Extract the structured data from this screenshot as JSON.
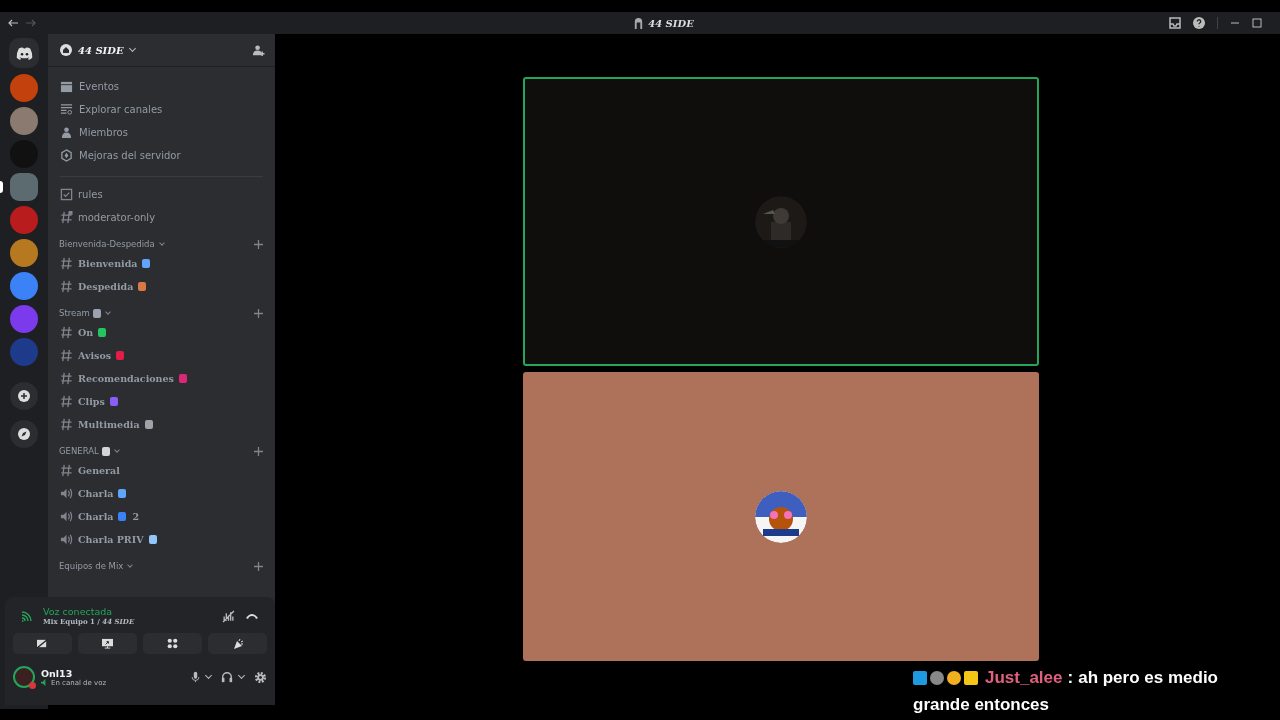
{
  "window": {
    "title": "44 SIDE"
  },
  "servers": [
    {
      "color": "#c2410c",
      "selected": false
    },
    {
      "color": "#8a7a70",
      "selected": false
    },
    {
      "color": "#111111",
      "selected": false
    },
    {
      "color": "#5b6b70",
      "selected": true
    },
    {
      "color": "#b91c1c",
      "selected": false
    },
    {
      "color": "#b7791f",
      "selected": false
    },
    {
      "color": "#3b82f6",
      "selected": false
    },
    {
      "color": "#7c3aed",
      "selected": false
    },
    {
      "color": "#1e3a8a",
      "selected": false
    }
  ],
  "server": {
    "name": "44 SIDE"
  },
  "menu_items": [
    {
      "kind": "events",
      "label": "Eventos"
    },
    {
      "kind": "browse",
      "label": "Explorar canales"
    },
    {
      "kind": "members",
      "label": "Miembros"
    },
    {
      "kind": "boost",
      "label": "Mejoras del servidor"
    }
  ],
  "channel_list": [
    {
      "kind": "rules",
      "name": "rules"
    },
    {
      "kind": "locked",
      "name": "moderator-only"
    },
    {
      "kind": "category",
      "name": "Bienvenida-Despedida"
    },
    {
      "kind": "text",
      "name": "Bienvenida",
      "color": "#60a5fa"
    },
    {
      "kind": "text",
      "name": "Despedida",
      "color": "#d97745"
    },
    {
      "kind": "category",
      "name": "Stream",
      "color": "#9ca3af"
    },
    {
      "kind": "text",
      "name": "On",
      "color": "#22c55e"
    },
    {
      "kind": "text",
      "name": "Avisos",
      "color": "#e11d48"
    },
    {
      "kind": "text",
      "name": "Recomendaciones",
      "color": "#db2777"
    },
    {
      "kind": "text",
      "name": "Clips",
      "color": "#8b5cf6"
    },
    {
      "kind": "text",
      "name": "Multimedia",
      "color": "#a1a1aa"
    },
    {
      "kind": "category",
      "name": "GENERAL",
      "color": "#d4d4d8"
    },
    {
      "kind": "text",
      "name": "General"
    },
    {
      "kind": "voice",
      "name": "Charla",
      "color": "#60a5fa"
    },
    {
      "kind": "voice",
      "name": "Charla",
      "color": "#3b82f6",
      "suffix": "2"
    },
    {
      "kind": "voice_locked",
      "name": "Charla PRIV",
      "color": "#93c5fd"
    },
    {
      "kind": "category",
      "name": "Equipos de Mix"
    }
  ],
  "voice_panel": {
    "status": "Voz conectada",
    "channel": "Mix Equipo 1 / ",
    "server": "44 SIDE"
  },
  "user": {
    "name": "Onl13",
    "status": "En canal de voz"
  },
  "tiles": [
    {
      "color": "#100e0c",
      "speaking": true,
      "kind": "picture"
    },
    {
      "color": "#ad7259",
      "speaking": false,
      "kind": "picture"
    }
  ],
  "chat": {
    "username": "Just_alee",
    "separator": ":",
    "message_lines": [
      "ah pero es medio",
      "grande entonces"
    ]
  }
}
